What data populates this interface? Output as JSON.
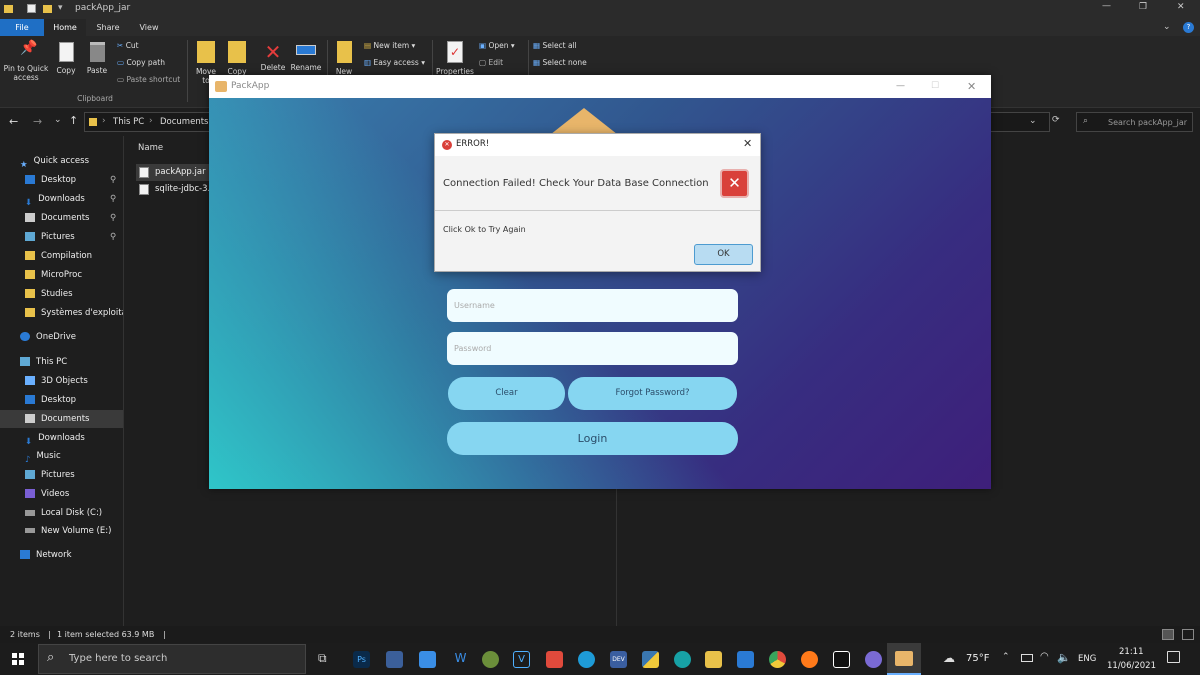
{
  "explorer": {
    "window_title": "packApp_jar",
    "tabs": [
      "File",
      "Home",
      "Share",
      "View"
    ],
    "ribbon": {
      "pin": "Pin to Quick access",
      "copy": "Copy",
      "paste": "Paste",
      "cut": "Cut",
      "copy_path": "Copy path",
      "paste_shortcut": "Paste shortcut",
      "clipboard_group": "Clipboard",
      "move_to": "Move to",
      "copy_to": "Copy to",
      "delete": "Delete",
      "rename": "Rename",
      "new_folder": "New",
      "new_item": "New item",
      "easy_access": "Easy access",
      "properties": "Properties",
      "open": "Open",
      "edit": "Edit",
      "select_all": "Select all",
      "select_none": "Select none"
    },
    "breadcrumb": [
      "This PC",
      "Documents"
    ],
    "search_placeholder": "Search packApp_jar",
    "nav": [
      "Quick access",
      "Desktop",
      "Downloads",
      "Documents",
      "Pictures",
      "Compilation",
      "MicroProc",
      "Studies",
      "Systèmes d'exploita",
      "OneDrive",
      "This PC",
      "3D Objects",
      "Desktop",
      "Documents",
      "Downloads",
      "Music",
      "Pictures",
      "Videos",
      "Local Disk (C:)",
      "New Volume (E:)",
      "Network"
    ],
    "column_name": "Name",
    "files": [
      "packApp.jar",
      "sqlite-jdbc-3."
    ],
    "status": {
      "items": "2 items",
      "selected": "1 item selected  63.9 MB"
    }
  },
  "app": {
    "title": "PackApp",
    "username_placeholder": "Username",
    "password_placeholder": "Password",
    "clear": "Clear",
    "forgot": "Forgot Password?",
    "login": "Login"
  },
  "dialog": {
    "title": "ERROR!",
    "message": "Connection Failed! Check Your Data Base Connection",
    "detail": "Click Ok to Try Again",
    "ok": "OK"
  },
  "taskbar": {
    "search_placeholder": "Type here to search",
    "weather": "75°F",
    "lang": "ENG",
    "time": "21:11",
    "date": "11/06/2021"
  },
  "colors": {
    "accent": "#86d6f1",
    "error": "#d9403a",
    "selection": "#3a3a3a"
  }
}
